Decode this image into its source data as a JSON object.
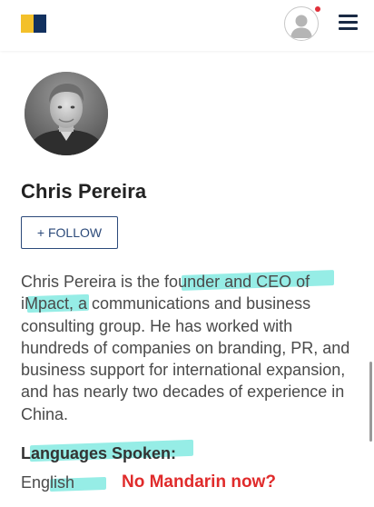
{
  "colors": {
    "logo_yellow": "#f3c02a",
    "logo_navy": "#12315f",
    "notification_dot": "#e0303a",
    "follow_text": "#2c4a7a",
    "highlight": "#6ee6dd",
    "annotation_red": "#e02b2b"
  },
  "header": {
    "logo_icon": "brand-logo-icon",
    "user_icon": "user-profile-icon",
    "menu_icon": "hamburger-menu-icon"
  },
  "author": {
    "name": "Chris Pereira",
    "follow_label": "+ FOLLOW",
    "bio": "Chris Pereira is the founder and CEO of iMpact, a communications and business consulting group. He has worked with hundreds of companies on branding, PR, and business support for international expansion, and has nearly two decades of experience in China."
  },
  "languages": {
    "heading": "Languages Spoken:",
    "value": "English"
  },
  "annotation": {
    "text": "No Mandarin now?"
  }
}
